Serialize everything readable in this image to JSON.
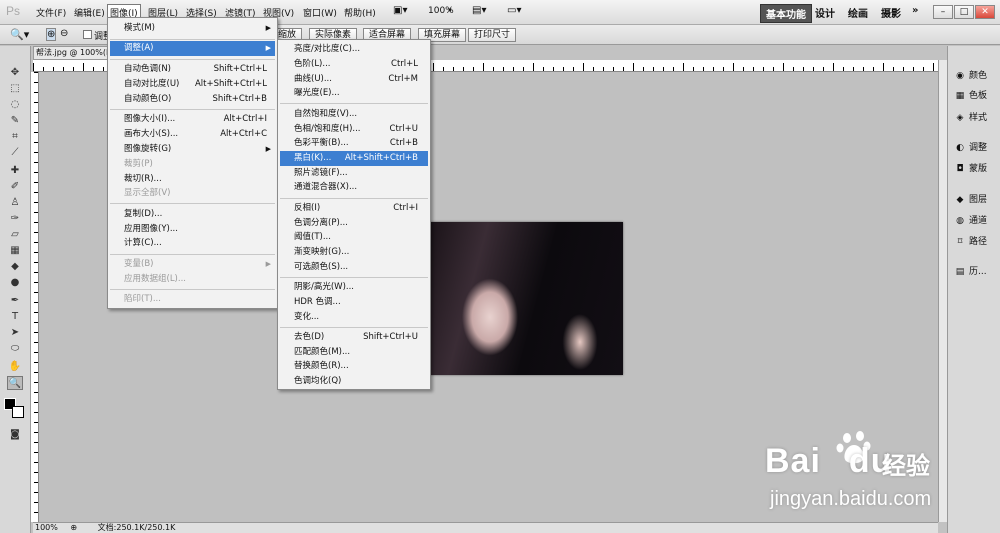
{
  "app": {
    "logo": "Ps"
  },
  "menubar": {
    "items": [
      "文件(F)",
      "编辑(E)",
      "图像(I)",
      "图层(L)",
      "选择(S)",
      "滤镜(T)",
      "视图(V)",
      "窗口(W)",
      "帮助(H)"
    ],
    "zoom": "100%",
    "workspaces": [
      "基本功能",
      "设计",
      "绘画",
      "摄影"
    ],
    "more": "»"
  },
  "options": {
    "resize_windows": "调整",
    "zoom_all": "缩放",
    "actual_pixels": "实际像素",
    "fit_screen": "适合屏幕",
    "fill_screen": "填充屏幕",
    "print_size": "打印尺寸"
  },
  "document": {
    "tab": "帮法.jpg @ 100%(RGB/8)",
    "zoom": "100%",
    "doc_info": "文档:250.1K/250.1K"
  },
  "image_menu": {
    "items": [
      {
        "label": "模式(M)",
        "arrow": true
      },
      {
        "label": "调整(A)",
        "arrow": true,
        "highlighted": true
      },
      {
        "label": "自动色调(N)",
        "shortcut": "Shift+Ctrl+L"
      },
      {
        "label": "自动对比度(U)",
        "shortcut": "Alt+Shift+Ctrl+L"
      },
      {
        "label": "自动颜色(O)",
        "shortcut": "Shift+Ctrl+B"
      },
      {
        "label": "图像大小(I)...",
        "shortcut": "Alt+Ctrl+I"
      },
      {
        "label": "画布大小(S)...",
        "shortcut": "Alt+Ctrl+C"
      },
      {
        "label": "图像旋转(G)",
        "arrow": true
      },
      {
        "label": "裁剪(P)",
        "disabled": true
      },
      {
        "label": "裁切(R)..."
      },
      {
        "label": "显示全部(V)",
        "disabled": true
      },
      {
        "label": "复制(D)..."
      },
      {
        "label": "应用图像(Y)..."
      },
      {
        "label": "计算(C)..."
      },
      {
        "label": "变量(B)",
        "arrow": true,
        "disabled": true
      },
      {
        "label": "应用数据组(L)...",
        "disabled": true
      },
      {
        "label": "陷印(T)...",
        "disabled": true
      }
    ]
  },
  "adjust_menu": {
    "items": [
      {
        "label": "亮度/对比度(C)..."
      },
      {
        "label": "色阶(L)...",
        "shortcut": "Ctrl+L"
      },
      {
        "label": "曲线(U)...",
        "shortcut": "Ctrl+M"
      },
      {
        "label": "曝光度(E)..."
      },
      {
        "label": "自然饱和度(V)..."
      },
      {
        "label": "色相/饱和度(H)...",
        "shortcut": "Ctrl+U"
      },
      {
        "label": "色彩平衡(B)...",
        "shortcut": "Ctrl+B"
      },
      {
        "label": "黑白(K)...",
        "shortcut": "Alt+Shift+Ctrl+B",
        "highlighted": true
      },
      {
        "label": "照片滤镜(F)..."
      },
      {
        "label": "通道混合器(X)..."
      },
      {
        "label": "反相(I)",
        "shortcut": "Ctrl+I"
      },
      {
        "label": "色调分离(P)..."
      },
      {
        "label": "阈值(T)..."
      },
      {
        "label": "渐变映射(G)..."
      },
      {
        "label": "可选颜色(S)..."
      },
      {
        "label": "阴影/高光(W)..."
      },
      {
        "label": "HDR 色调..."
      },
      {
        "label": "变化..."
      },
      {
        "label": "去色(D)",
        "shortcut": "Shift+Ctrl+U"
      },
      {
        "label": "匹配颜色(M)..."
      },
      {
        "label": "替换颜色(R)..."
      },
      {
        "label": "色调均化(Q)"
      }
    ]
  },
  "panels": {
    "items": [
      "颜色",
      "色板",
      "样式",
      "调整",
      "蒙版",
      "图层",
      "通道",
      "路径",
      "历..."
    ]
  },
  "watermark": {
    "brand": "Bai",
    "brand2": "du",
    "jingyan": "经验",
    "url": "jingyan.baidu.com"
  },
  "colors": {
    "highlight": "#3d7fd1",
    "menu_bg": "#f2f2f2",
    "canvas": "#c0c0c0"
  }
}
